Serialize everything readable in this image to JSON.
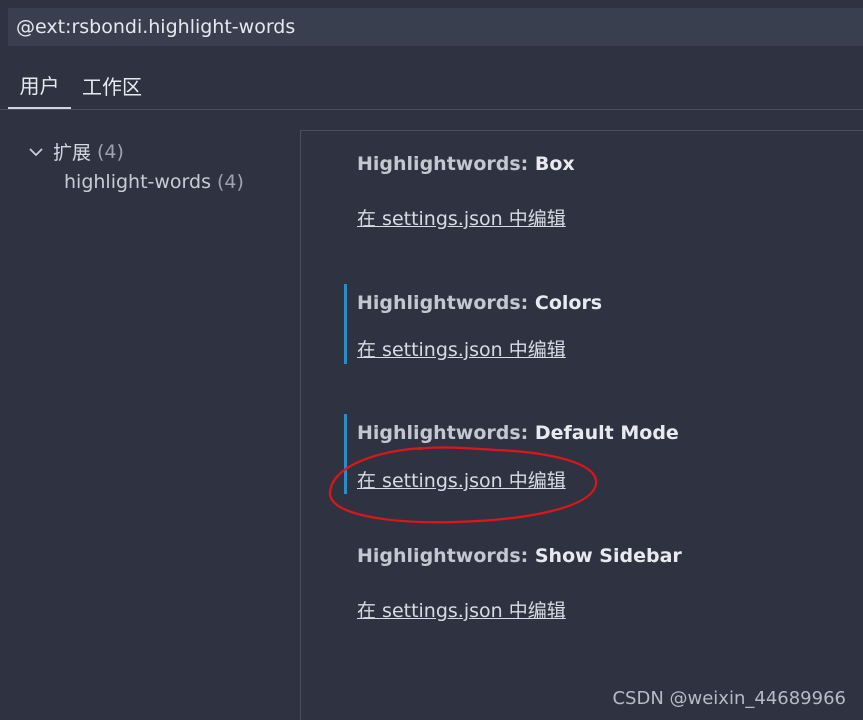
{
  "search": {
    "value": "@ext:rsbondi.highlight-words"
  },
  "tabs": [
    {
      "label": "用户",
      "active": true
    },
    {
      "label": "工作区",
      "active": false
    }
  ],
  "tree": {
    "root": {
      "label": "扩展",
      "count": "(4)",
      "icon": "chevron-down-icon"
    },
    "child": {
      "label": "highlight-words",
      "count": "(4)"
    }
  },
  "settings": [
    {
      "category": "Highlightwords: ",
      "name": "Box",
      "link": "在 settings.json 中编辑",
      "focused": false
    },
    {
      "category": "Highlightwords: ",
      "name": "Colors",
      "link": "在 settings.json 中编辑",
      "focused": true
    },
    {
      "category": "Highlightwords: ",
      "name": "Default Mode",
      "link": "在 settings.json 中编辑",
      "focused": true
    },
    {
      "category": "Highlightwords: ",
      "name": "Show Sidebar",
      "link": "在 settings.json 中编辑",
      "focused": false
    }
  ],
  "annotation": {
    "shape": "red-ellipse",
    "color": "#e0141b"
  },
  "watermark": "CSDN @weixin_44689966",
  "colors": {
    "background": "#2f3341",
    "search_background": "#3a3f4f",
    "focus_accent": "#2a8ec4"
  }
}
